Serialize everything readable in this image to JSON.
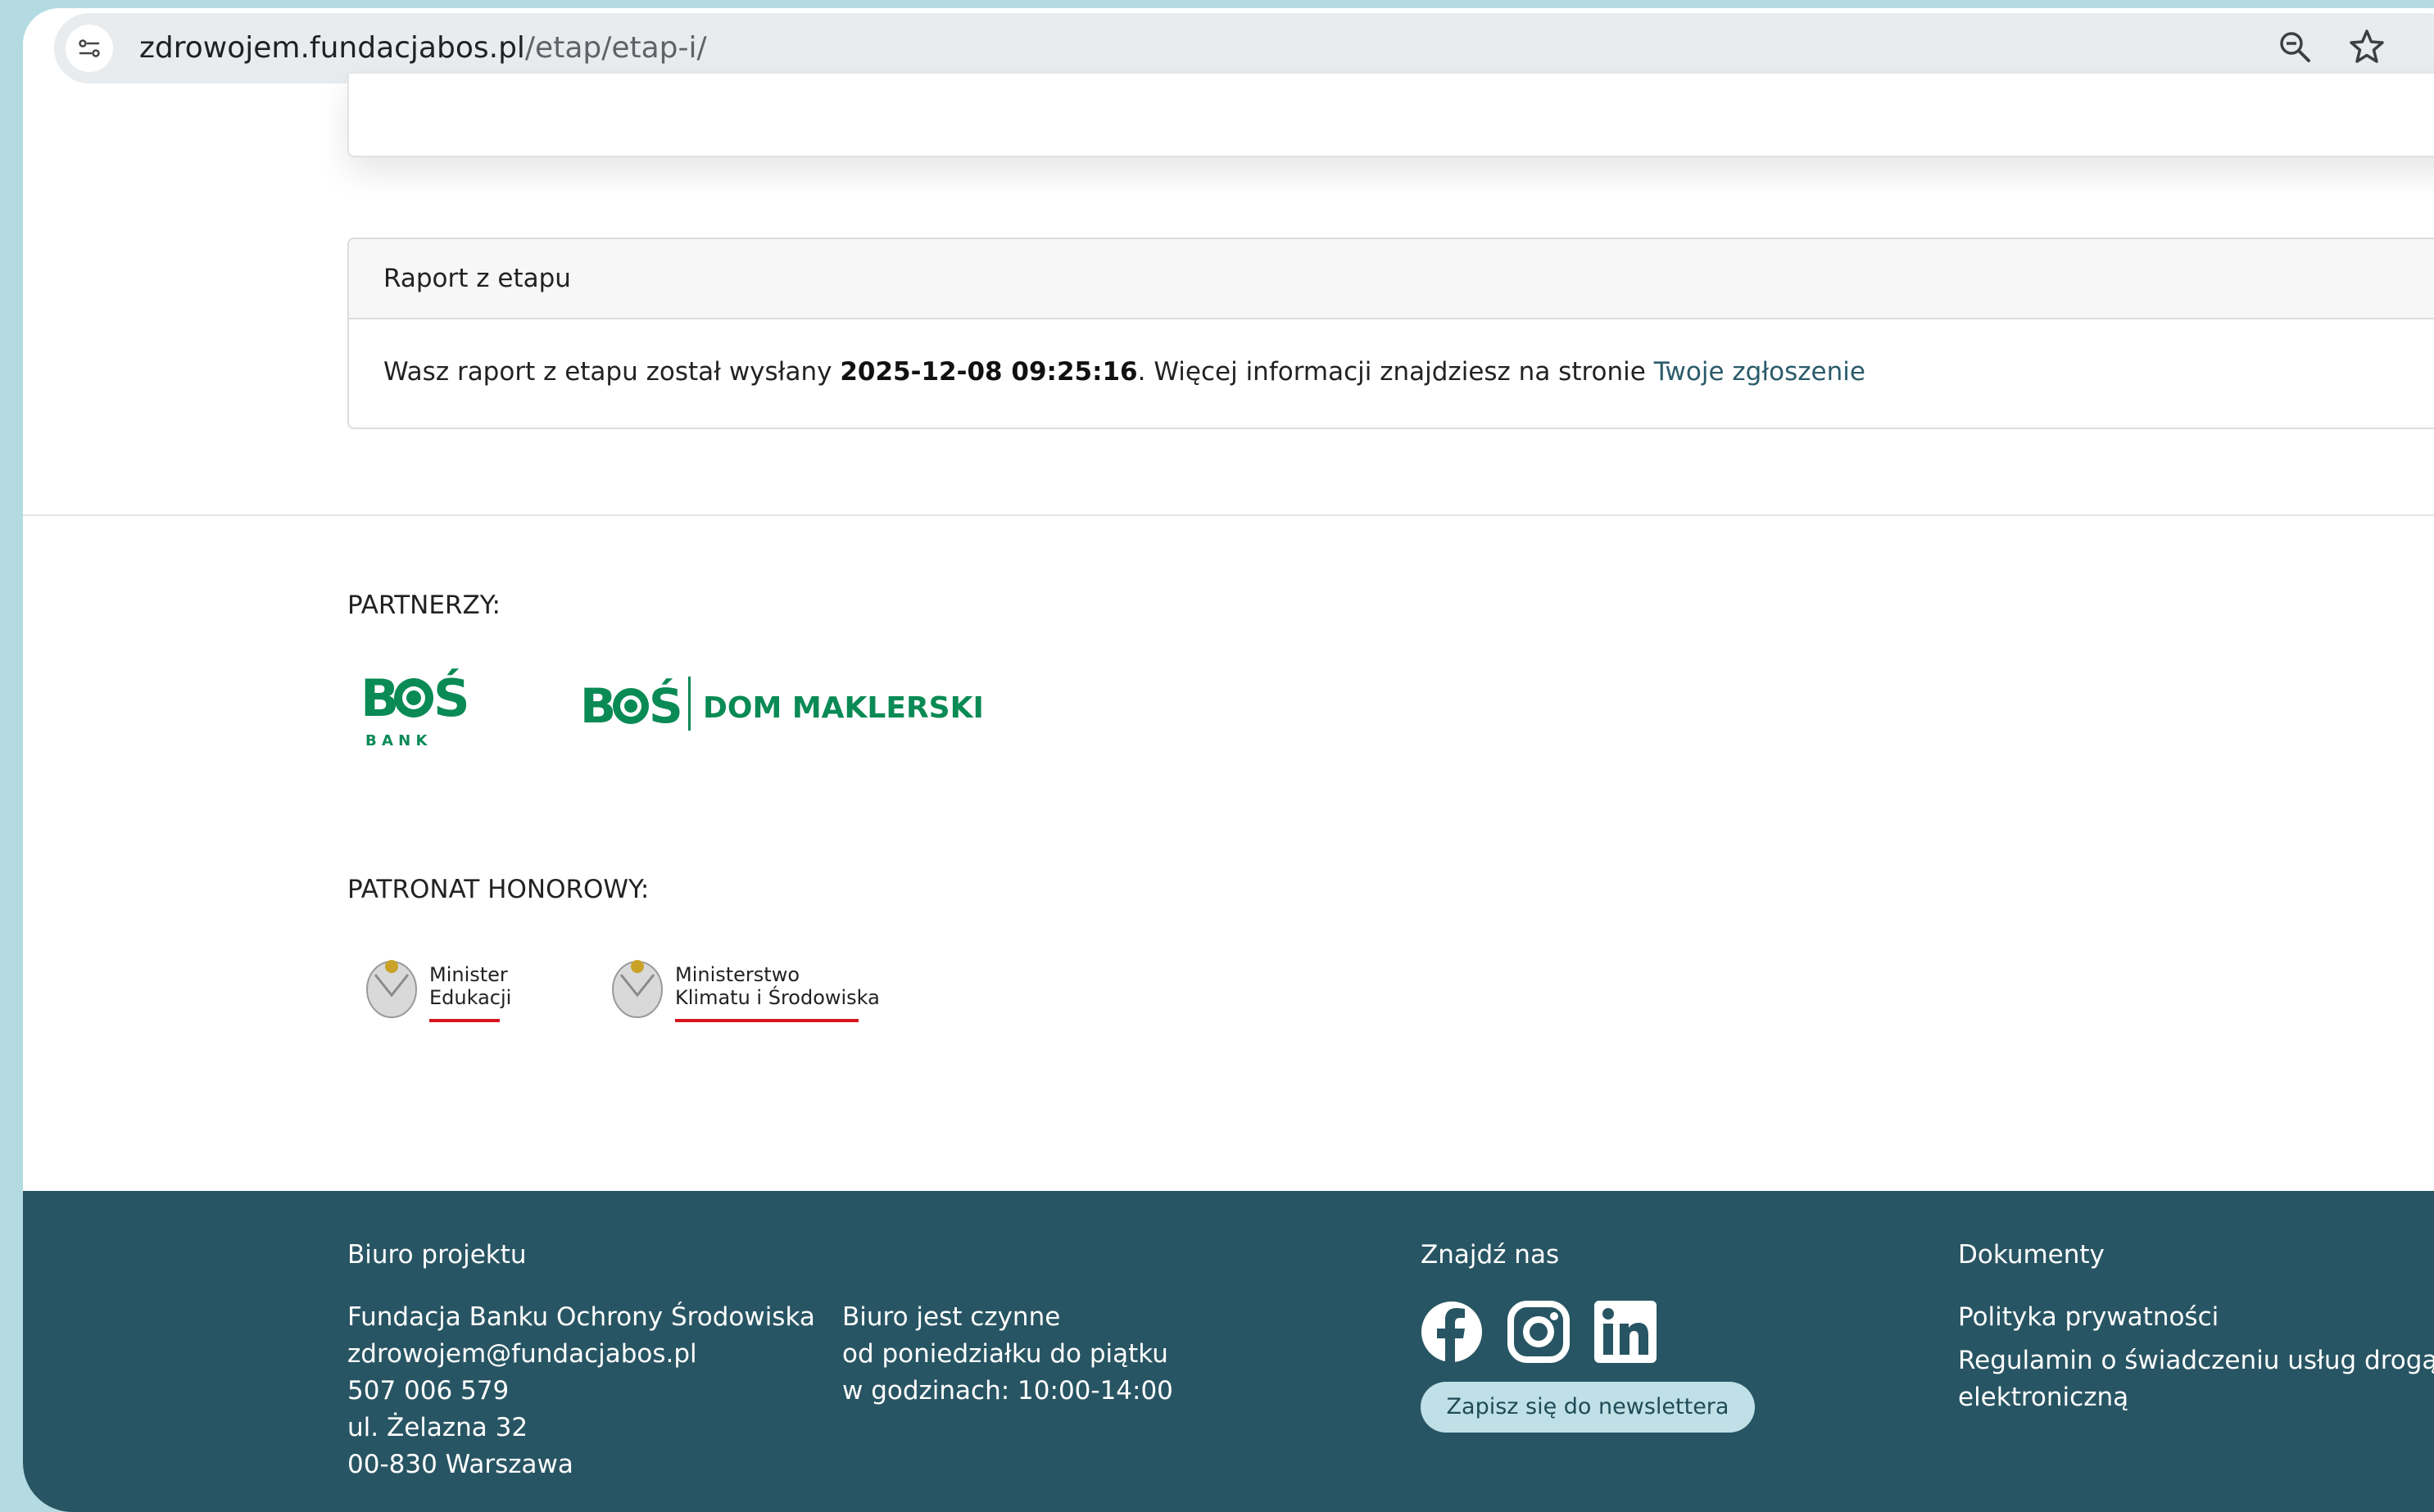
{
  "browser": {
    "url_host": "zdrowojem.fundacjabos.pl",
    "url_path": "/etap/etap-i/"
  },
  "report": {
    "title": "Raport z etapu",
    "text_before": "Wasz raport z etapu został wysłany ",
    "timestamp": "2025-12-08 09:25:16",
    "text_after": ". Więcej informacji znajdziesz na stronie ",
    "link_label": "Twoje zgłoszenie"
  },
  "partners": {
    "label": "PARTNERZY:",
    "logos": [
      {
        "name": "BOŚ Bank",
        "line1": "B",
        "line2": "Ś",
        "sub": "B A N K"
      },
      {
        "name": "BOŚ Dom Maklerski",
        "line1": "B",
        "line2": "Ś",
        "text": "DOM MAKLERSKI"
      }
    ]
  },
  "patronage": {
    "label": "PATRONAT HONOROWY:",
    "logos": [
      {
        "line1": "Minister",
        "line2": "Edukacji"
      },
      {
        "line1": "Ministerstwo",
        "line2": "Klimatu i Środowiska"
      }
    ]
  },
  "footer": {
    "office_heading": "Biuro projektu",
    "office_lines": [
      "Fundacja Banku Ochrony Środowiska",
      "zdrowojem@fundacjabos.pl",
      "507 006 579",
      "ul. Żelazna 32",
      "00-830 Warszawa"
    ],
    "hours_lines": [
      "Biuro jest czynne",
      "od poniedziałku do piątku",
      "w godzinach: 10:00-14:00"
    ],
    "social_heading": "Znajdź nas",
    "social_icons": [
      "facebook-icon",
      "instagram-icon",
      "linkedin-icon"
    ],
    "newsletter_label": "Zapisz się do newslettera",
    "docs_heading": "Dokumenty",
    "docs_links": [
      "Polityka prywatności",
      "Regulamin o świadczeniu usług drogą",
      "elektroniczną"
    ]
  },
  "colors": {
    "footer_bg": "#285563",
    "brand_green": "#0a8a55",
    "link": "#2a5b6a",
    "backdrop": "#b3dbe1"
  }
}
